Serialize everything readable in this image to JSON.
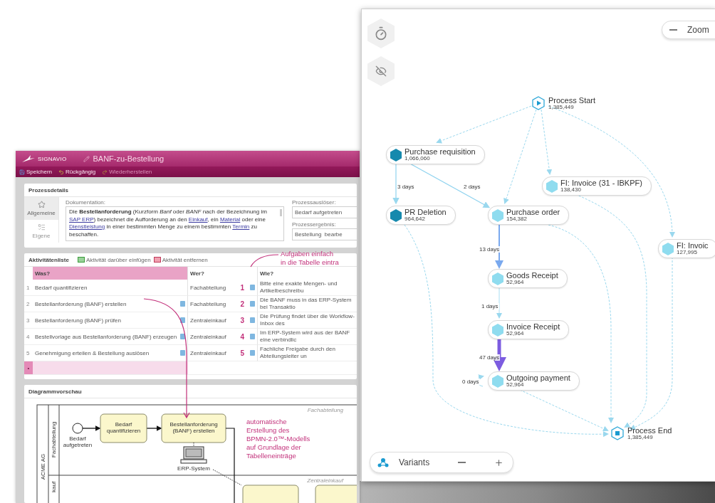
{
  "editor": {
    "logo": "SIGNAVIO",
    "title": "BANF-zu-Bestellung",
    "toolbar": [
      {
        "kind": "save",
        "label": "Speichern",
        "disabled": false
      },
      {
        "kind": "undo",
        "label": "Rückgängig",
        "disabled": false
      },
      {
        "kind": "redo",
        "label": "Wiederherstellen",
        "disabled": true
      }
    ],
    "process_details": {
      "title": "Prozessdetails",
      "tabs": [
        {
          "kind": "general",
          "label": "Allgemeine",
          "selected": true
        },
        {
          "kind": "custom",
          "label": "Eigene",
          "selected": false
        }
      ],
      "documentation_label": "Dokumentation:",
      "documentation": [
        {
          "kind": "plain",
          "text": "Die "
        },
        {
          "kind": "bold",
          "text": "Bestellanforderung"
        },
        {
          "kind": "plain",
          "text": " (Kurzform "
        },
        {
          "kind": "italic",
          "text": "Banf"
        },
        {
          "kind": "plain",
          "text": " oder "
        },
        {
          "kind": "italic",
          "text": "BANF"
        },
        {
          "kind": "plain",
          "text": " nach der Bezeichnung im "
        },
        {
          "kind": "link",
          "text": "SAP ERP"
        },
        {
          "kind": "plain",
          "text": ") bezeichnet die Aufforderung an den "
        },
        {
          "kind": "link",
          "text": "Einkauf"
        },
        {
          "kind": "plain",
          "text": ", ein "
        },
        {
          "kind": "link",
          "text": "Material"
        },
        {
          "kind": "plain",
          "text": " oder eine "
        },
        {
          "kind": "link",
          "text": "Dienstleistung"
        },
        {
          "kind": "plain",
          "text": " in einer bestimmten Menge zu einem bestimmten "
        },
        {
          "kind": "link",
          "text": "Termin"
        },
        {
          "kind": "plain",
          "text": " zu beschaffen."
        }
      ],
      "fields": [
        {
          "label": "Prozessauslöser:",
          "value": "Bedarf aufgetreten"
        },
        {
          "label": "Prozessergebnis:",
          "value": "Bestellung  bearbe"
        }
      ]
    },
    "activity_list": {
      "title": "Aktivitätenliste",
      "actions": [
        {
          "kind": "insert",
          "label": "Aktivität darüber einfügen"
        },
        {
          "kind": "remove",
          "label": "Aktivität entfernen"
        }
      ],
      "columns": [
        {
          "label": "Was?",
          "selected": true
        },
        {
          "label": "Wer?",
          "selected": false
        },
        {
          "label": "Wie?",
          "selected": false
        }
      ],
      "rows": [
        {
          "number": "1",
          "what": "Bedarf quantifizieren",
          "what_note": false,
          "who": "Fachabteilung",
          "mark": "1",
          "how": "Bitte eine exakte Mengen- und Artikelbeschreibu"
        },
        {
          "number": "2",
          "what": "Bestellanforderung (BANF) erstellen",
          "what_note": true,
          "who": "Fachabteilung",
          "mark": "2",
          "how": "Die BANF muss in das ERP-System bei Transaktio"
        },
        {
          "number": "3",
          "what": "Bestellanforderung (BANF) prüfen",
          "what_note": true,
          "who": "Zentraleinkauf",
          "mark": "3",
          "how": "Die Prüfung findet über die Workflow-Inbox des"
        },
        {
          "number": "4",
          "what": "Bestellvorlage aus Bestellanforderung (BANF) erzeugen",
          "what_note": true,
          "who": "Zentraleinkauf",
          "mark": "4",
          "how": "Im ERP-System wird aus der BANF eine verbindlic"
        },
        {
          "number": "5",
          "what": "Genehmigung erteilen & Bestellung auslösen",
          "what_note": true,
          "who": "Zentraleinkauf",
          "mark": "5",
          "how": "Fachliche Freigabe durch den Abteilungsleiter un"
        }
      ],
      "add_row": "•"
    },
    "diagram_preview": {
      "title": "Diagrammvorschau",
      "pool": "ACME AG",
      "lanes": [
        {
          "label": "Fachabteilung",
          "caption": "Fachabteilung"
        },
        {
          "label": "kauf",
          "caption": "Zentraleinkauf"
        }
      ],
      "start_event": [
        "Bedarf",
        "aufgetreten"
      ],
      "tasks": [
        [
          "Bedarf",
          "quantifizieren"
        ],
        [
          "Bestellanforderung",
          "(BANF) erstellen"
        ]
      ],
      "system": "ERP-System"
    },
    "annotations": [
      [
        "Aufgaben einfach",
        "in die Tabelle eintra"
      ],
      [
        "automatische",
        "Erstellung des",
        "BPMN-2.0™-Modells",
        "auf Grundlage der",
        "Tabelleneinträge"
      ]
    ]
  },
  "process_map": {
    "zoom_label": "Zoom",
    "variants_label": "Variants",
    "nodes": [
      {
        "kind": "start",
        "name": "Process Start",
        "count": "1,385,449"
      },
      {
        "kind": "activity",
        "name": "Purchase requisition",
        "count": "1,066,060",
        "color": "#1589ad"
      },
      {
        "kind": "activity",
        "name": "FI: Invoice (31 - IBKPF)",
        "count": "138,430",
        "color": "#8fdcef"
      },
      {
        "kind": "activity",
        "name": "PR Deletion",
        "count": "964,642",
        "color": "#1589ad"
      },
      {
        "kind": "activity",
        "name": "Purchase order",
        "count": "154,382",
        "color": "#8fdcef"
      },
      {
        "kind": "activity",
        "name": "FI: Invoic",
        "count": "127,995",
        "color": "#8fdcef"
      },
      {
        "kind": "activity",
        "name": "Goods Receipt",
        "count": "52,964",
        "color": "#8fdcef"
      },
      {
        "kind": "activity",
        "name": "Invoice Receipt",
        "count": "52,964",
        "color": "#8fdcef"
      },
      {
        "kind": "activity",
        "name": "Outgoing payment",
        "count": "52,964",
        "color": "#8fdcef"
      },
      {
        "kind": "end",
        "name": "Process End",
        "count": "1,385,449"
      }
    ],
    "edge_labels": [
      "3 days",
      "2 days",
      "13 days",
      "1 days",
      "47 days",
      "0 days"
    ]
  }
}
